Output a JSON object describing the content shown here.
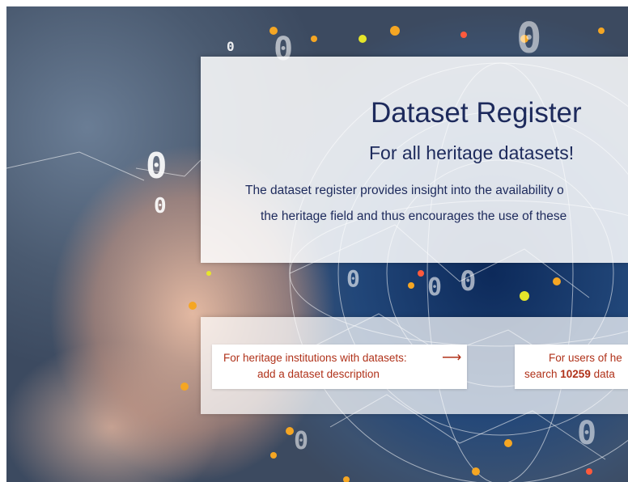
{
  "hero": {
    "title": "Dataset Register",
    "subtitle": "For all heritage datasets!",
    "intro_line_1": "The dataset register provides insight into the availability o",
    "intro_line_2": "the heritage field and thus encourages the use of these"
  },
  "actions": {
    "institutions": {
      "line_1": "For heritage institutions with datasets:",
      "line_2": "add a dataset description",
      "arrow": "⟶"
    },
    "users": {
      "line_1": "For users of he",
      "line_2_prefix": "search ",
      "dataset_count": "10259",
      "line_2_suffix": " data"
    }
  },
  "colors": {
    "title": "#1d2a5c",
    "action_text": "#b0321a"
  },
  "background_digits": [
    "0",
    "0",
    "0",
    "0",
    "0",
    "0",
    "0",
    "0",
    "0",
    "0"
  ]
}
